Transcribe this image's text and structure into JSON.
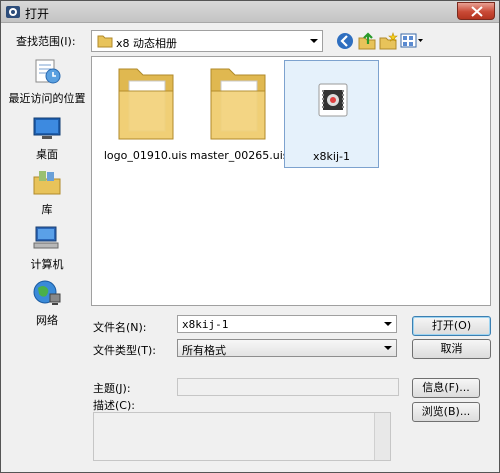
{
  "window": {
    "title": "打开"
  },
  "lookin": {
    "label": "查找范围(I):",
    "value": "x8 动态相册"
  },
  "toolbar": {
    "back_icon": "back-icon",
    "up_icon": "up-folder-icon",
    "new_folder_icon": "new-folder-icon",
    "view_icon": "view-menu-icon"
  },
  "places": [
    {
      "label": "最近访问的位置",
      "icon": "recent-places-icon"
    },
    {
      "label": "桌面",
      "icon": "desktop-icon"
    },
    {
      "label": "库",
      "icon": "libraries-icon"
    },
    {
      "label": "计算机",
      "icon": "computer-icon"
    },
    {
      "label": "网络",
      "icon": "network-icon"
    }
  ],
  "files": [
    {
      "name": "logo_01910.uis",
      "type": "folder"
    },
    {
      "name": "master_00265.uis",
      "type": "folder"
    },
    {
      "name": "x8kij-1",
      "type": "video",
      "selected": true
    }
  ],
  "form": {
    "filename_label": "文件名(N):",
    "filename_value": "x8kij-1",
    "filetype_label": "文件类型(T):",
    "filetype_value": "所有格式",
    "subject_label": "主题(J):",
    "description_label": "描述(C):"
  },
  "buttons": {
    "open": "打开(O)",
    "cancel": "取消",
    "info": "信息(F)...",
    "browse": "浏览(B)..."
  }
}
